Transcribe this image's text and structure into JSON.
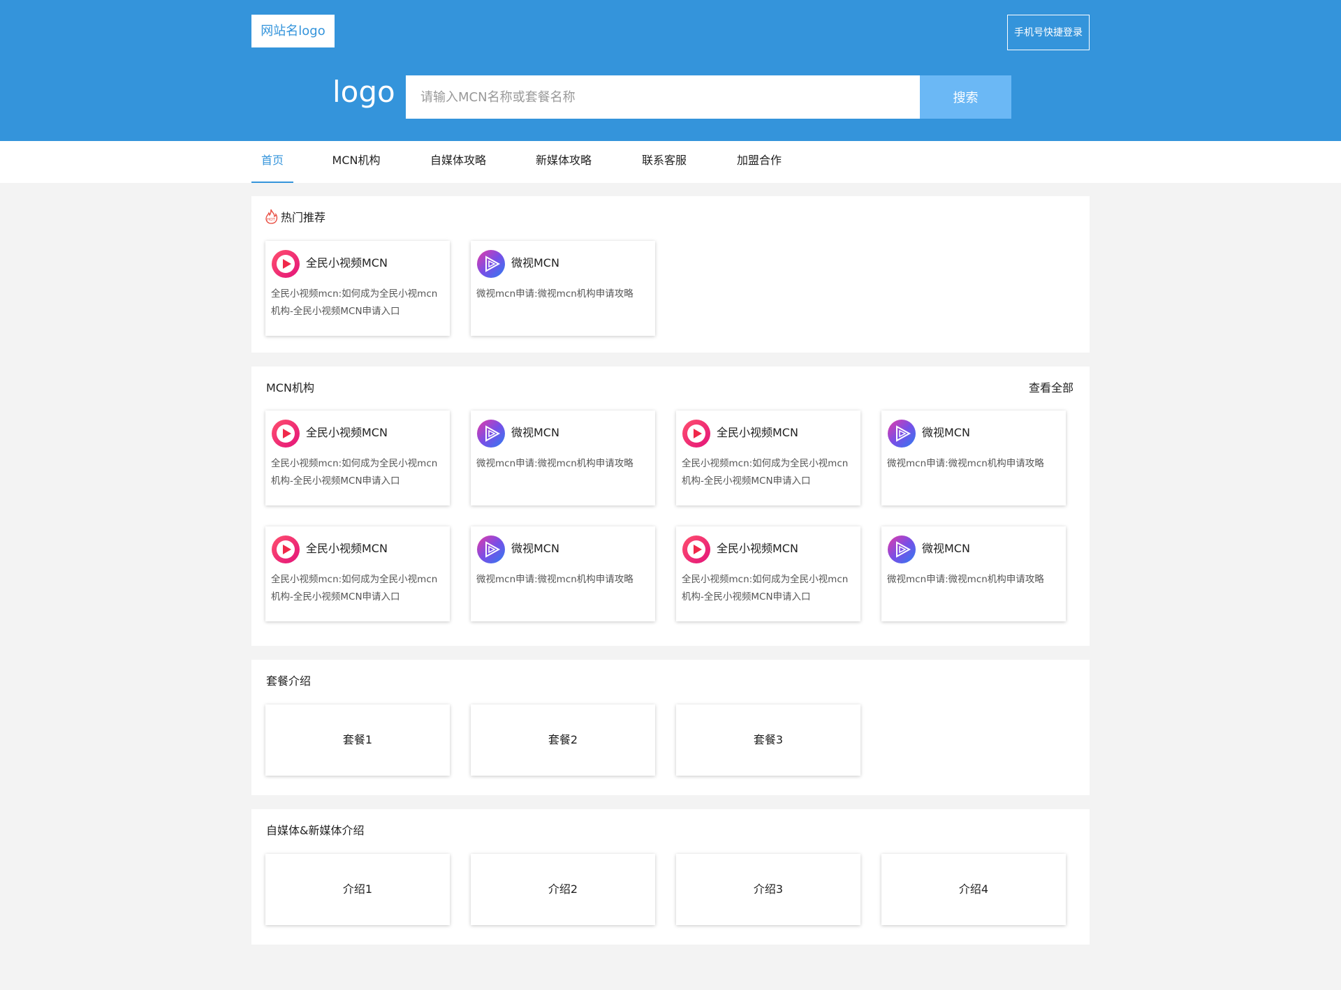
{
  "header": {
    "site_logo": "网站名logo",
    "login_button": "手机号快捷登录",
    "big_logo": "logo",
    "search_placeholder": "请输入MCN名称或套餐名称",
    "search_button": "搜索"
  },
  "colors": {
    "brand_blue": "#3494db",
    "search_button": "#6bb8f5",
    "hot_icon": "#e8473b"
  },
  "nav": {
    "items": [
      {
        "label": "首页",
        "active": true
      },
      {
        "label": "MCN机构"
      },
      {
        "label": "自媒体攻略"
      },
      {
        "label": "新媒体攻略"
      },
      {
        "label": "联系客服"
      },
      {
        "label": "加盟合作"
      }
    ]
  },
  "hot": {
    "title": "热门推荐",
    "icon": "hot-fire-icon",
    "cards": [
      {
        "name": "全民小视频MCN",
        "icon": "quanmin-video-icon",
        "desc": "全民小视频mcn:如何成为全民小视mcn机构-全民小视频MCN申请入口"
      },
      {
        "name": "微视MCN",
        "icon": "weishi-icon",
        "desc": "微视mcn申请:微视mcn机构申请攻略"
      }
    ]
  },
  "mcn": {
    "title": "MCN机构",
    "view_all": "查看全部",
    "cards": [
      {
        "name": "全民小视频MCN",
        "icon": "quanmin-video-icon",
        "desc": "全民小视频mcn:如何成为全民小视mcn机构-全民小视频MCN申请入口"
      },
      {
        "name": "微视MCN",
        "icon": "weishi-icon",
        "desc": "微视mcn申请:微视mcn机构申请攻略"
      },
      {
        "name": "全民小视频MCN",
        "icon": "quanmin-video-icon",
        "desc": "全民小视频mcn:如何成为全民小视mcn机构-全民小视频MCN申请入口"
      },
      {
        "name": "微视MCN",
        "icon": "weishi-icon",
        "desc": "微视mcn申请:微视mcn机构申请攻略"
      },
      {
        "name": "全民小视频MCN",
        "icon": "quanmin-video-icon",
        "desc": "全民小视频mcn:如何成为全民小视mcn机构-全民小视频MCN申请入口"
      },
      {
        "name": "微视MCN",
        "icon": "weishi-icon",
        "desc": "微视mcn申请:微视mcn机构申请攻略"
      },
      {
        "name": "全民小视频MCN",
        "icon": "quanmin-video-icon",
        "desc": "全民小视频mcn:如何成为全民小视mcn机构-全民小视频MCN申请入口"
      },
      {
        "name": "微视MCN",
        "icon": "weishi-icon",
        "desc": "微视mcn申请:微视mcn机构申请攻略"
      }
    ]
  },
  "packages": {
    "title": "套餐介绍",
    "items": [
      "套餐1",
      "套餐2",
      "套餐3"
    ]
  },
  "media": {
    "title": "自媒体&新媒体介绍",
    "items": [
      "介绍1",
      "介绍2",
      "介绍3",
      "介绍4"
    ]
  }
}
